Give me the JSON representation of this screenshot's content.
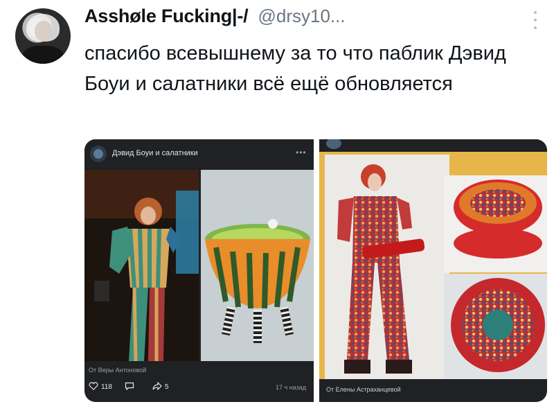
{
  "tweet": {
    "display_name": "Asshøle Fucking|-/",
    "handle": "@drsy10...",
    "text": "спасибо всевышнему за то что паблик Дэвид Боуи и салатники всё ещё обновляется",
    "menu_icon": "more-vertical-icon"
  },
  "embed_left": {
    "group_title": "Дэвид Боуи и салатники",
    "caption": "От Веры Антоновой",
    "likes": "118",
    "shares": "5",
    "time": "17 ч назад",
    "icons": [
      "heart-icon",
      "comment-icon",
      "share-icon"
    ]
  },
  "embed_right": {
    "caption": "От Елены Астраханцевой"
  },
  "colors": {
    "text": "#0f1419",
    "secondary": "#6b7681",
    "embed_bg": "#1f2124",
    "collage_bg": "#e7b64a"
  }
}
